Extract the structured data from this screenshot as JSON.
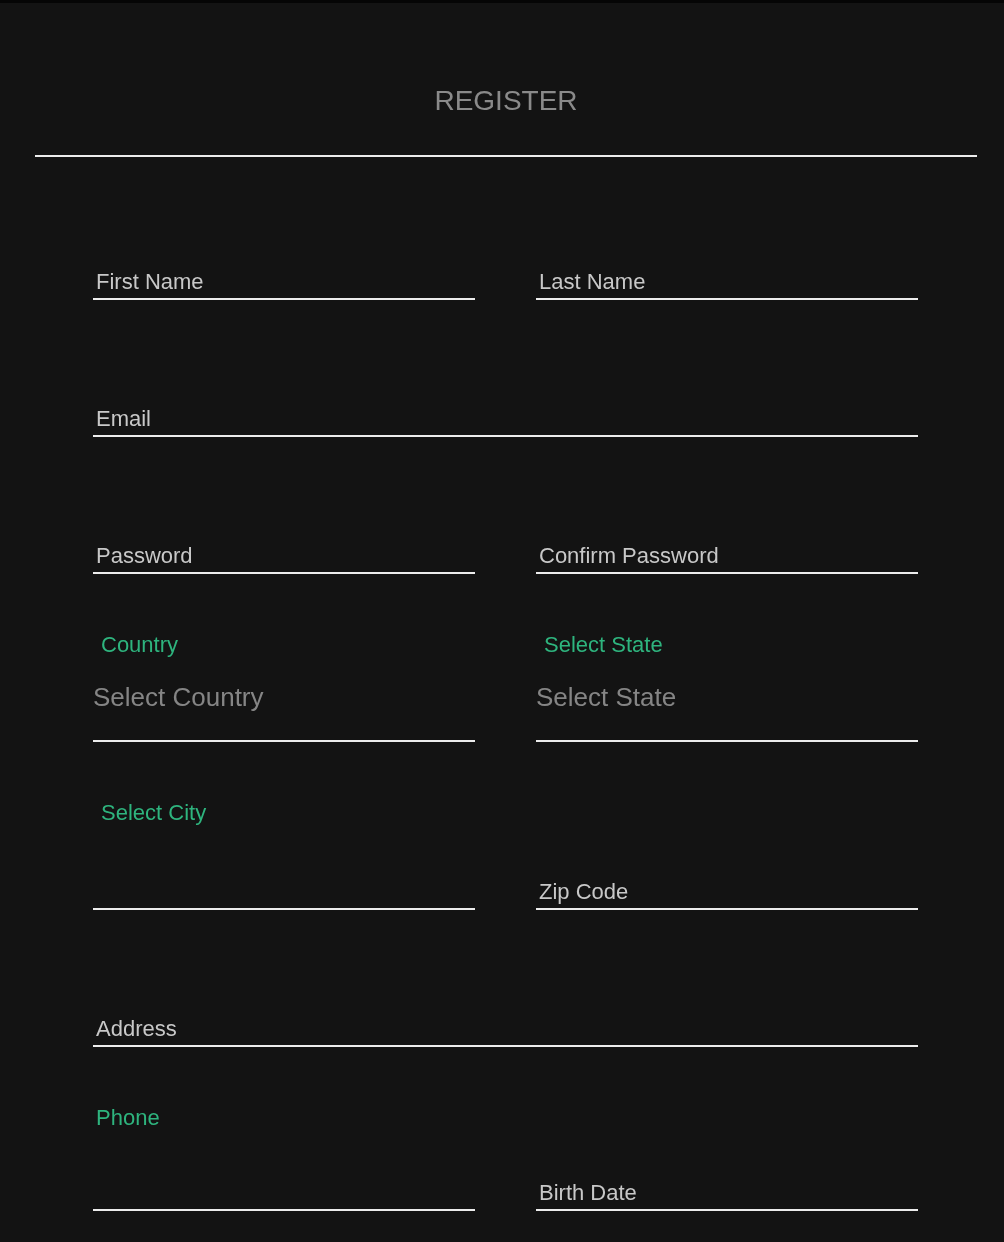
{
  "title": "REGISTER",
  "rows": [
    {
      "fields": [
        {
          "kind": "input",
          "placeholder": "First Name"
        },
        {
          "kind": "input",
          "placeholder": "Last Name"
        }
      ]
    },
    {
      "fields": [
        {
          "kind": "input",
          "placeholder": "Email"
        }
      ]
    },
    {
      "fields": [
        {
          "kind": "input",
          "placeholder": "Password"
        },
        {
          "kind": "input",
          "placeholder": "Confirm Password"
        }
      ]
    },
    {
      "fields": [
        {
          "kind": "select",
          "label": "Country",
          "placeholder": "Select Country"
        },
        {
          "kind": "select",
          "label": "Select State",
          "placeholder": "Select State"
        }
      ]
    },
    {
      "fields": [
        {
          "kind": "select",
          "label": "Select City"
        },
        {
          "kind": "input",
          "placeholder": "Zip Code"
        }
      ]
    },
    {
      "fields": [
        {
          "kind": "input",
          "placeholder": "Address"
        }
      ]
    },
    {
      "fields": [
        {
          "kind": "labeled",
          "label": "Phone"
        },
        {
          "kind": "input",
          "placeholder": "Birth Date"
        }
      ]
    }
  ]
}
